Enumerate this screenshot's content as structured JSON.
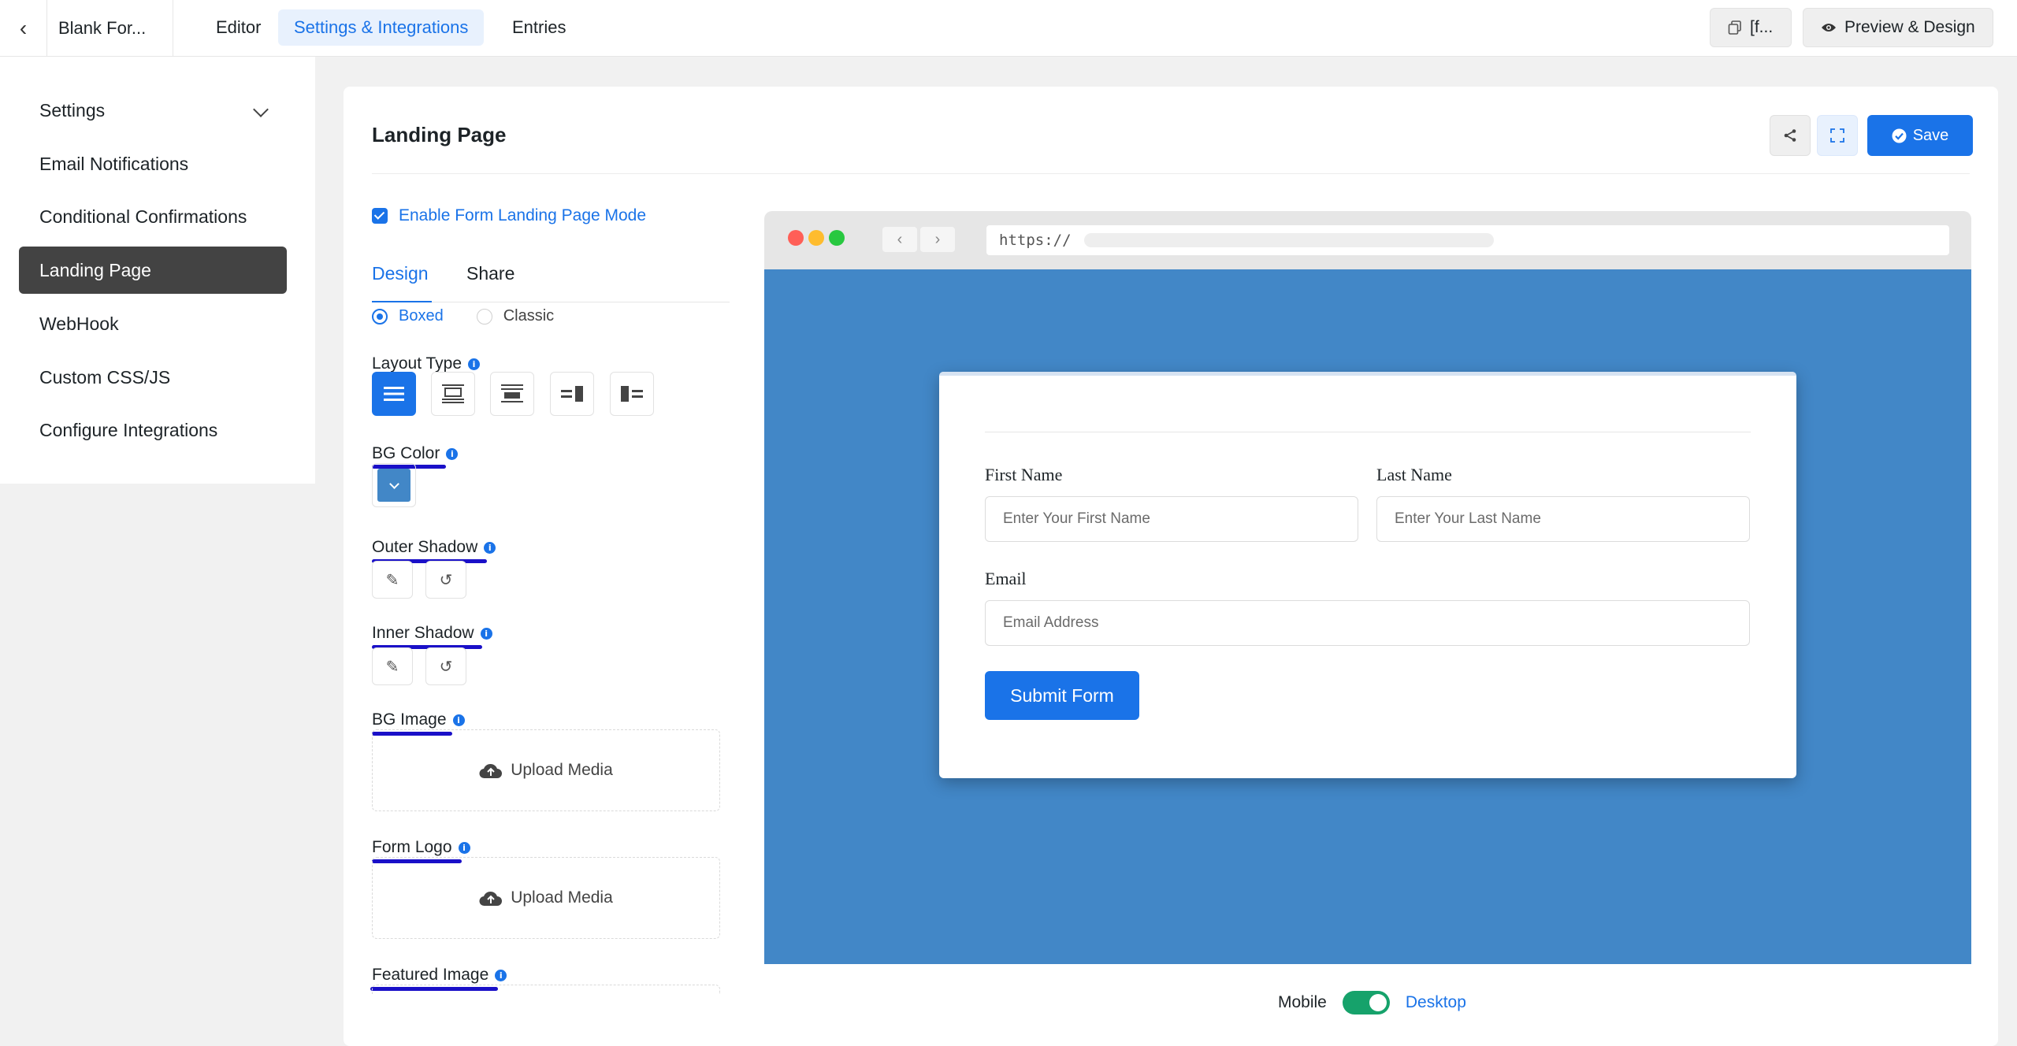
{
  "topbar": {
    "form_name": "Blank For...",
    "tabs": [
      {
        "label": "Editor"
      },
      {
        "label": "Settings & Integrations"
      },
      {
        "label": "Entries"
      }
    ],
    "shortcode_label": "[f...",
    "preview_label": "Preview & Design"
  },
  "sidebar": {
    "items": [
      {
        "label": "Settings"
      },
      {
        "label": "Email Notifications"
      },
      {
        "label": "Conditional Confirmations"
      },
      {
        "label": "Landing Page"
      },
      {
        "label": "WebHook"
      },
      {
        "label": "Custom CSS/JS"
      },
      {
        "label": "Configure Integrations"
      }
    ],
    "active": "Landing Page"
  },
  "panel": {
    "title": "Landing Page",
    "save_label": "Save",
    "enable_label": "Enable Form Landing Page Mode",
    "tabs": [
      {
        "label": "Design"
      },
      {
        "label": "Share"
      }
    ],
    "style_options": [
      {
        "label": "Boxed"
      },
      {
        "label": "Classic"
      }
    ],
    "layout_type_label": "Layout Type",
    "bg_color_label": "BG Color",
    "bg_color_value": "#4287c7",
    "outer_shadow_label": "Outer Shadow",
    "inner_shadow_label": "Inner Shadow",
    "bg_image_label": "BG Image",
    "form_logo_label": "Form Logo",
    "featured_image_label": "Featured Image",
    "upload_label": "Upload Media"
  },
  "preview": {
    "url": "https://",
    "form": {
      "first_name_label": "First Name",
      "first_name_placeholder": "Enter Your First Name",
      "last_name_label": "Last Name",
      "last_name_placeholder": "Enter Your Last Name",
      "email_label": "Email",
      "email_placeholder": "Email Address",
      "submit_label": "Submit Form"
    },
    "mobile_label": "Mobile",
    "desktop_label": "Desktop"
  },
  "colors": {
    "accent": "#1a73e8",
    "sidebar_active": "#434343",
    "preview_bg": "#4287c7",
    "toggle_on": "#16a26b",
    "annotation_ink": "#1a10c8"
  }
}
